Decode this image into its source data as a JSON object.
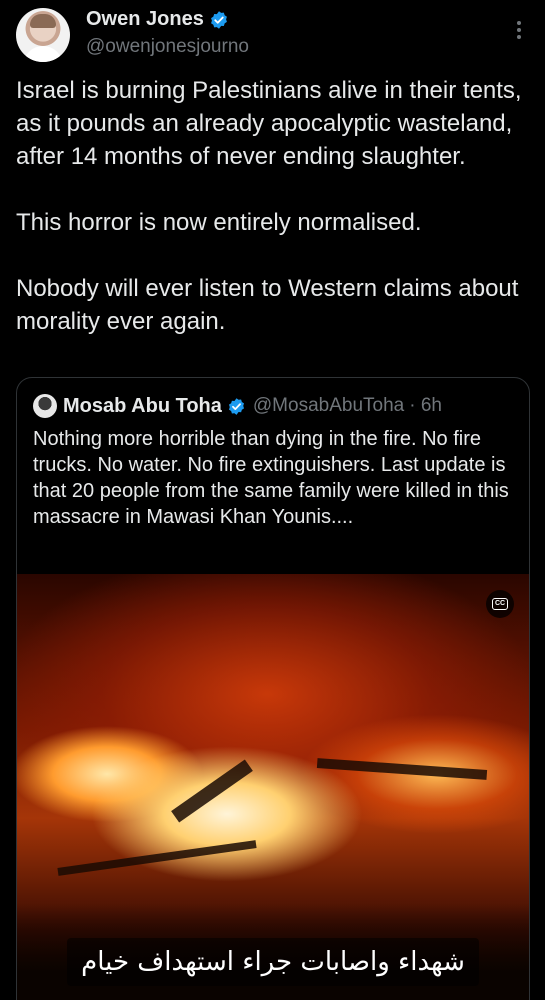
{
  "tweet": {
    "author_name": "Owen Jones",
    "author_handle": "@owenjonesjourno",
    "verified": true,
    "menu_icon": "more-vertical-icon",
    "paragraphs": [
      "Israel is burning Palestinians alive in their tents, as it pounds an already apocalyptic wasteland, after 14 months of never ending slaughter.",
      "This horror is now entirely normalised.",
      "Nobody will ever listen to Western claims about morality ever again."
    ]
  },
  "quoted": {
    "author_name": "Mosab Abu Toha",
    "author_handle": "@MosabAbuToha",
    "time": "· 6h",
    "verified": true,
    "text": "Nothing more horrible than dying in the fire. No fire trucks. No water. No fire extinguishers. Last update is that 20 people from the same family were killed in this massacre in Mawasi Khan Younis....",
    "video": {
      "cc_label": "CC",
      "caption": "شهداء واصابات جراء استهداف خيام"
    }
  },
  "colors": {
    "background": "#000000",
    "text": "#e7e9ea",
    "secondary": "#71767b",
    "verified": "#1d9bf0",
    "border": "#2f3336"
  }
}
